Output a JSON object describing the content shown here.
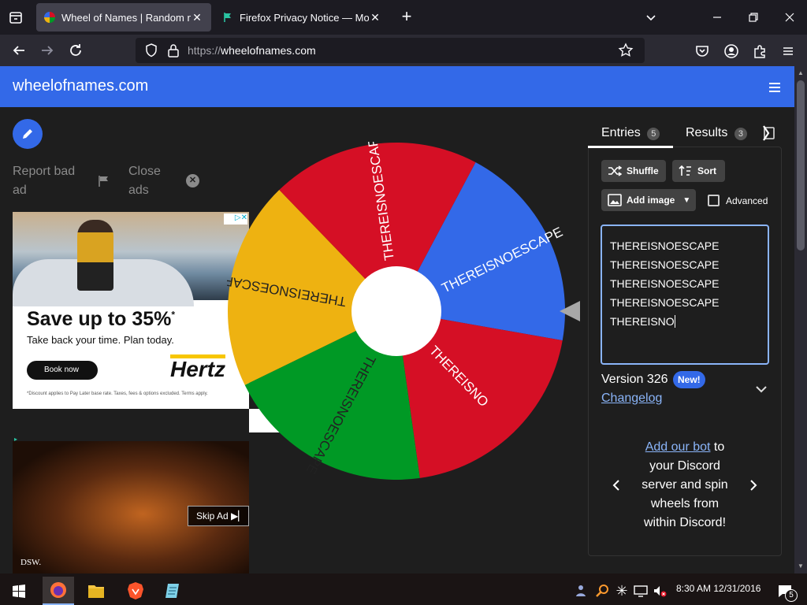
{
  "browser": {
    "tabs": [
      {
        "title": "Wheel of Names | Random name picker",
        "active": true
      },
      {
        "title": "Firefox Privacy Notice — Mozilla",
        "active": false
      }
    ],
    "url": "https://wheelofnames.com",
    "url_scheme": "https://",
    "url_host": "wheelofnames.com"
  },
  "site": {
    "logo": "wheelofnames.com"
  },
  "ads": {
    "report_label": "Report bad ad",
    "close_label": "Close ads",
    "hertz": {
      "headline": "Save up to 35%",
      "headline_mark": "*",
      "sub": "Take back your time. Plan today.",
      "cta": "Book now",
      "brand": "Hertz",
      "fineprint": "*Discount applies to Pay Later base rate. Taxes, fees & options excluded. Terms apply."
    },
    "video": {
      "skip": "Skip Ad",
      "brand": "DSW."
    }
  },
  "wheel": {
    "slices": [
      {
        "label": "THEREISNOESCAPE",
        "color": "#3369e8"
      },
      {
        "label": "THEREISNO",
        "color": "#d50f25"
      },
      {
        "label": "THEREISNOESCAPE",
        "color": "#009925"
      },
      {
        "label": "THEREISNOESCAPE",
        "color": "#eeb211"
      },
      {
        "label": "THEREISNOESCAPE",
        "color": "#d50f25"
      }
    ]
  },
  "panel": {
    "tabs": [
      {
        "label": "Entries",
        "count": "5"
      },
      {
        "label": "Results",
        "count": "3"
      }
    ],
    "shuffle": "Shuffle",
    "sort": "Sort",
    "add_image": "Add image",
    "advanced": "Advanced",
    "entries": [
      "THEREISNOESCAPE",
      "THEREISNOESCAPE",
      "THEREISNOESCAPE",
      "THEREISNOESCAPE",
      "THEREISNO"
    ],
    "version": "Version 326",
    "new_badge": "New!",
    "changelog": "Changelog",
    "discord": {
      "link": "Add our bot",
      "text1": " to",
      "text2": "your Discord",
      "text3": "server and spin",
      "text4": "wheels from",
      "text5": "within Discord!"
    }
  },
  "taskbar": {
    "time": "8:30 AM",
    "date": "12/31/2016",
    "notifications": "5"
  },
  "colors": {
    "header": "#3369e8",
    "accent": "#3369e8"
  }
}
